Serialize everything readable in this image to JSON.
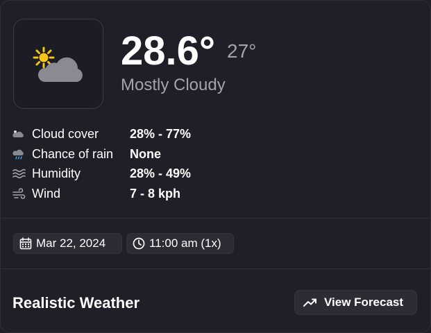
{
  "current": {
    "temperature": "28.6°",
    "feels_like": "27°",
    "condition": "Mostly Cloudy",
    "icon": "sun-behind-cloud-icon"
  },
  "metrics": [
    {
      "label": "Cloud cover",
      "value": "28% - 77%",
      "icon": "cloud-icon"
    },
    {
      "label": "Chance of rain",
      "value": "None",
      "icon": "rain-cloud-icon"
    },
    {
      "label": "Humidity",
      "value": "28% - 49%",
      "icon": "humidity-waves-icon"
    },
    {
      "label": "Wind",
      "value": "7 - 8 kph",
      "icon": "wind-icon"
    }
  ],
  "datetime": {
    "date": "Mar 22, 2024",
    "time": "11:00 am (1x)"
  },
  "footer": {
    "title": "Realistic Weather",
    "forecast_button": "View Forecast"
  },
  "colors": {
    "background": "#1f1f28",
    "text_primary": "#ffffff",
    "text_secondary": "#a3a3ad",
    "chip_background": "#2c2c35",
    "sun": "#f5c518",
    "cloud": "#8a8a92"
  }
}
